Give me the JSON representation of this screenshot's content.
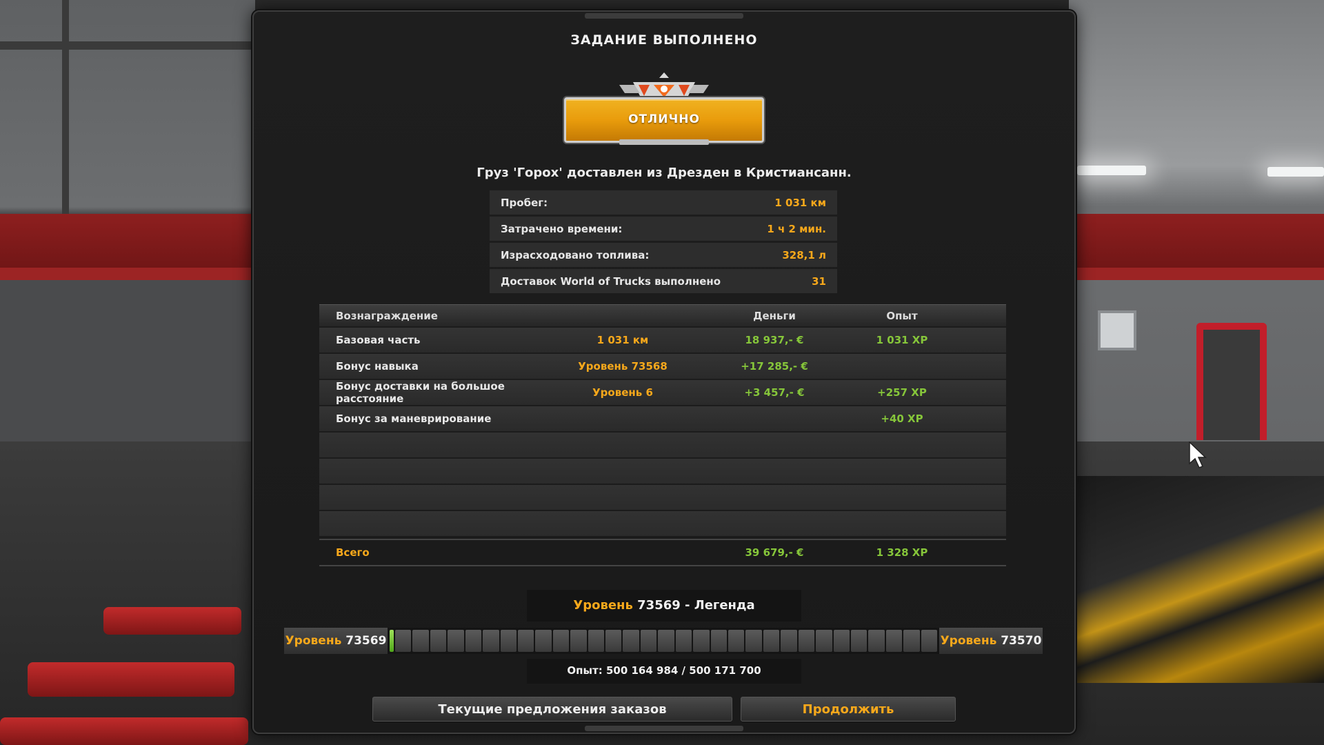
{
  "dialog": {
    "title": "ЗАДАНИЕ ВЫПОЛНЕНО",
    "rating_label": "ОТЛИЧНО",
    "delivery_message": "Груз 'Горох' доставлен из Дрезден в Кристиансанн."
  },
  "stats": [
    {
      "label": "Пробег:",
      "value": "1 031 км"
    },
    {
      "label": "Затрачено времени:",
      "value": "1 ч 2 мин."
    },
    {
      "label": "Израсходовано топлива:",
      "value": "328,1 л"
    },
    {
      "label": "Доставок World of Trucks выполнено",
      "value": "31"
    }
  ],
  "rewards": {
    "headers": {
      "reward": "Вознаграждение",
      "money": "Деньги",
      "xp": "Опыт"
    },
    "rows": [
      {
        "name": "Базовая часть",
        "extra": "1 031 км",
        "money": "18 937,- €",
        "xp": "1 031 XP"
      },
      {
        "name": "Бонус навыка",
        "extra": "Уровень 73568",
        "money": "+17 285,- €",
        "xp": ""
      },
      {
        "name": "Бонус доставки на большое расстояние",
        "extra": "Уровень 6",
        "money": "+3 457,- €",
        "xp": "+257 XP"
      },
      {
        "name": "Бонус за маневрирование",
        "extra": "",
        "money": "",
        "xp": "+40 XP"
      }
    ],
    "total": {
      "name": "Всего",
      "money": "39 679,- €",
      "xp": "1 328 XP"
    }
  },
  "level": {
    "level_word": "Уровень",
    "current_level": "73569",
    "rank_suffix": " - Легенда",
    "bar_left_number": "73569",
    "bar_right_number": "73570",
    "progress_fraction": 0.002,
    "segments": 32,
    "xp_text": "Опыт: 500 164 984 / 500 171 700"
  },
  "buttons": {
    "offers": "Текущие предложения заказов",
    "continue": "Продолжить"
  },
  "colors": {
    "accent_orange": "#f7a81b",
    "accent_green": "#86c63a",
    "panel_bg": "#1e1e1e"
  }
}
